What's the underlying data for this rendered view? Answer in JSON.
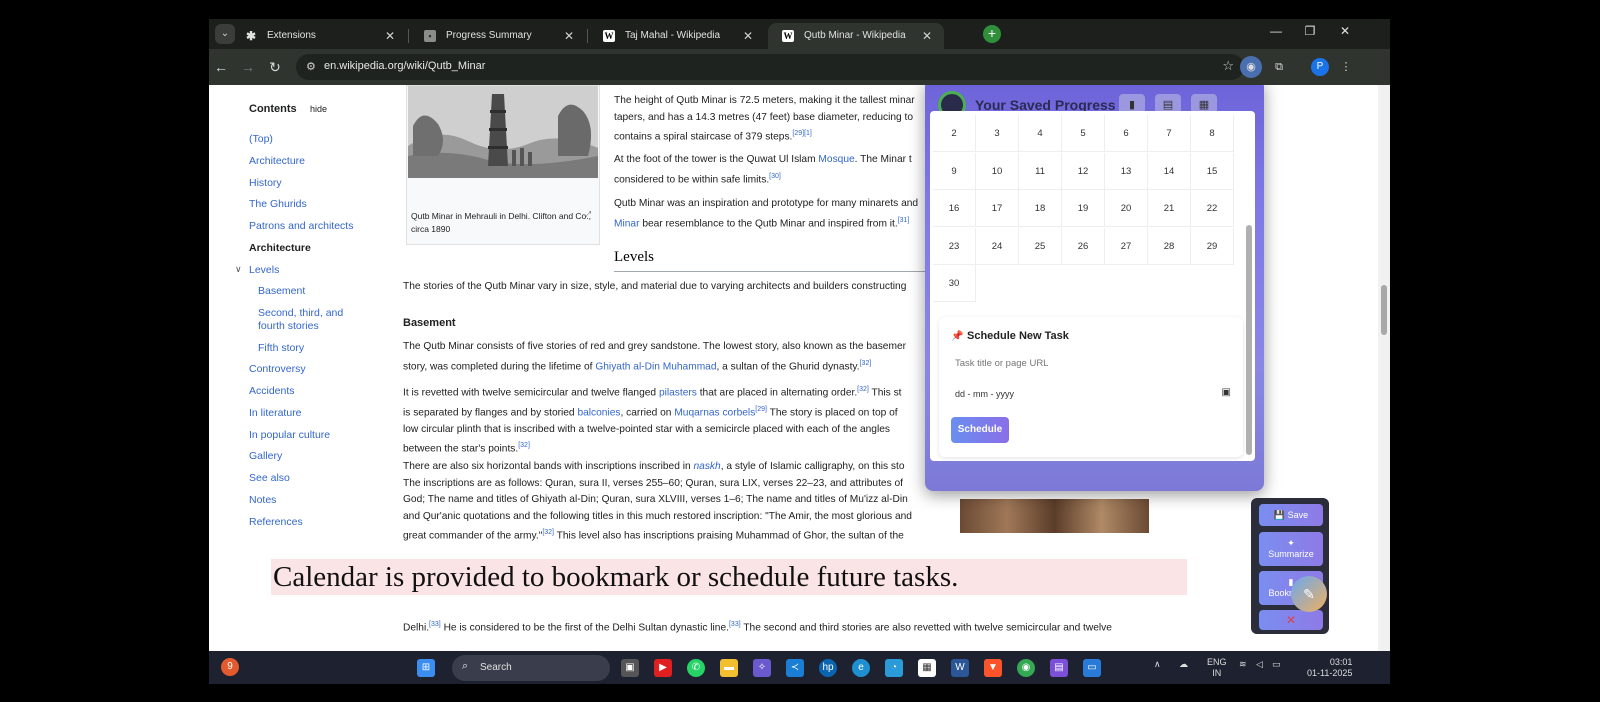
{
  "tabs": [
    {
      "label": "Extensions",
      "favicon": "puzzle-icon",
      "active": false
    },
    {
      "label": "Progress Summary",
      "favicon": "page-icon",
      "active": false
    },
    {
      "label": "Taj Mahal - Wikipedia",
      "favicon": "W",
      "active": false
    },
    {
      "label": "Qutb Minar - Wikipedia",
      "favicon": "W",
      "active": true
    }
  ],
  "address_bar": {
    "url": "en.wikipedia.org/wiki/Qutb_Minar"
  },
  "toc": {
    "heading": "Contents",
    "hide": "hide",
    "items": [
      {
        "label": "(Top)"
      },
      {
        "label": "Architecture"
      },
      {
        "label": "History"
      },
      {
        "label": "The Ghurids"
      },
      {
        "label": "Patrons and architects"
      },
      {
        "label": "Architecture"
      },
      {
        "label": "Levels"
      },
      {
        "label": "Basement"
      },
      {
        "label": "Second, third, and fourth stories"
      },
      {
        "label": "Fifth story"
      },
      {
        "label": "Controversy"
      },
      {
        "label": "Accidents"
      },
      {
        "label": "In literature"
      },
      {
        "label": "In popular culture"
      },
      {
        "label": "Gallery"
      },
      {
        "label": "See also"
      },
      {
        "label": "Notes"
      },
      {
        "label": "References"
      }
    ]
  },
  "figure": {
    "caption": "Qutb Minar in Mehrauli in Delhi. Clifton and Co., circa 1890"
  },
  "article": {
    "p1_l1": "The height of Qutb Minar is 72.5 meters, making it the tallest minar",
    "p1_l2": "tapers, and has a 14.3 metres (47 feet) base diameter, reducing to",
    "p1_l3": "contains a spiral staircase of 379 steps.",
    "p1_ref": "[29][1]",
    "p2_l1a": "At the foot of the tower is the Quwat Ul Islam",
    "p2_link": "Mosque",
    "p2_l1b": ". The Minar t",
    "p2_l2": "considered to be within safe limits.",
    "p2_ref": "[30]",
    "p3_l1": "Qutb Minar was an inspiration and prototype for many minarets and",
    "p3_link": "Minar",
    "p3_l2": " bear resemblance to the Qutb Minar and inspired from it.",
    "p3_ref": "[31]",
    "levels_heading": "Levels",
    "levels_text": "The stories of the Qutb Minar vary in size, style, and material due to varying architects and builders constructing",
    "basement_heading": "Basement",
    "b1_l1": "The Qutb Minar consists of five stories of red and grey sandstone. The lowest story, also known as the basemer",
    "b1_l2a": "story, was completed during the lifetime of",
    "b1_link": "Ghiyath al-Din Muhammad",
    "b1_l2b": ", a sultan of the Ghurid dynasty.",
    "b1_ref": "[32]",
    "b2_l1a": "It is revetted with twelve semicircular and twelve flanged",
    "b2_link1": "pilasters",
    "b2_l1b": " that are placed in alternating order.",
    "b2_ref1": "[32]",
    "b2_l1c": " This st",
    "b2_l2a": "is separated by flanges and by storied",
    "b2_link2": "balconies",
    "b2_l2b": ", carried on",
    "b2_link3": "Muqarnas corbels",
    "b2_ref2": "[29]",
    "b2_l2c": " The story is placed on top of",
    "b2_l3": "low circular plinth that is inscribed with a twelve-pointed star with a semicircle placed with each of the angles",
    "b2_l4": "between the star's points.",
    "b2_ref3": "[32]",
    "b3_l1a": "There are also six horizontal bands with inscriptions inscribed in",
    "b3_link": "naskh",
    "b3_l1b": ", a style of Islamic calligraphy, on this sto",
    "b3_l2": "The inscriptions are as follows: Quran, sura II, verses 255–60; Quran, sura LIX, verses 22–23, and attributes of",
    "b3_l3": "God; The name and titles of Ghiyath al-Din; Quran, sura XLVIII, verses 1–6; The name and titles of Mu'izz al-Din",
    "b3_l4": "and Qur'anic quotations and the following titles in this much restored inscription: \"The Amir, the most glorious and",
    "b3_l5": "great commander of the army.\"",
    "b3_ref": "[32]",
    "b3_l5b": " This level also has inscriptions praising Muhammad of Ghor, the sultan of the",
    "bottom_a": "Delhi.",
    "bottom_ref1": "[33]",
    "bottom_b": " He is considered to be the first of the Delhi Sultan dynastic line.",
    "bottom_ref2": "[33]",
    "bottom_c": " The second and third stories are also revetted with twelve semicircular and twelve"
  },
  "overlay_caption": "Calendar is provided to bookmark or schedule future tasks.",
  "popup": {
    "title": "Your Saved Progress",
    "days": [
      "2",
      "3",
      "4",
      "5",
      "6",
      "7",
      "8",
      "9",
      "10",
      "11",
      "12",
      "13",
      "14",
      "15",
      "16",
      "17",
      "18",
      "19",
      "20",
      "21",
      "22",
      "23",
      "24",
      "25",
      "26",
      "27",
      "28",
      "29",
      "30"
    ],
    "schedule": {
      "title": "Schedule New Task",
      "input_placeholder": "Task title or page URL",
      "date_placeholder": "dd - mm - yyyy",
      "button": "Schedule"
    }
  },
  "side_panel": {
    "save": "Save",
    "summarize": "Summarize",
    "bookmarks": "Bookmarks",
    "close": "✕"
  },
  "taskbar": {
    "search": "Search",
    "lang_top": "ENG",
    "lang_bottom": "IN",
    "time": "03:01",
    "date": "01-11-2025",
    "notif_count": "9"
  }
}
